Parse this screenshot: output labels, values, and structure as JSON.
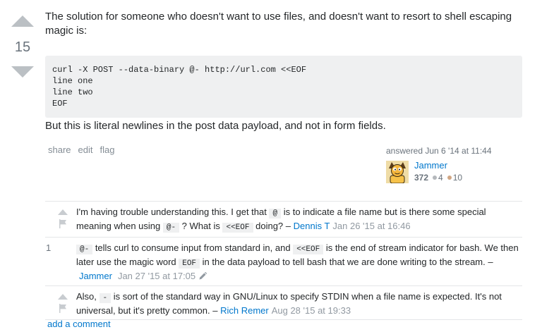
{
  "vote": {
    "count": "15"
  },
  "post": {
    "intro": "The solution for someone who doesn't want to use files, and doesn't want to resort to shell escaping magic is:",
    "code_lines": [
      "curl -X POST --data-binary @- http://url.com <<EOF",
      "line one",
      "line two",
      "EOF"
    ],
    "outro": "But this is literal newlines in the post data payload, and not in form fields."
  },
  "post_menu": {
    "share": "share",
    "edit": "edit",
    "flag": "flag"
  },
  "user_card": {
    "action_time": "answered Jun 6 '14 at 11:44",
    "name": "Jammer",
    "reputation": "372",
    "silver_badges": "4",
    "bronze_badges": "10"
  },
  "comments": [
    {
      "body": [
        {
          "text": "I'm having trouble understanding this. I get that "
        },
        {
          "code": "@"
        },
        {
          "text": " is to indicate a file name but is there some special meaning when using "
        },
        {
          "code": "@-"
        },
        {
          "text": " ? What is "
        },
        {
          "code": "<<EOF"
        },
        {
          "text": " doing? – "
        }
      ],
      "author": "Dennis T",
      "date": "Jan 26 '15 at 16:46"
    },
    {
      "score": "1",
      "body": [
        {
          "code": "@-"
        },
        {
          "text": " tells curl to consume input from standard in, and "
        },
        {
          "code": "<<EOF"
        },
        {
          "text": " is the end of stream indicator for bash. We then later use the magic word "
        },
        {
          "code": "EOF"
        },
        {
          "text": " in the data payload to tell bash that we are done writing to the stream. – "
        }
      ],
      "author": "Jammer",
      "date": "Jan 27 '15 at 17:05"
    },
    {
      "body": [
        {
          "text": "Also, "
        },
        {
          "code": "-"
        },
        {
          "text": " is sort of the standard way in GNU/Linux to specify STDIN when a file name is expected. It's not universal, but it's pretty common. – "
        }
      ],
      "author": "Rich Remer",
      "date": "Aug 28 '15 at 19:33"
    }
  ],
  "add_comment": "add a comment",
  "icons": {
    "upvote": "upvote-arrow-icon",
    "downvote": "downvote-arrow-icon",
    "comment_upvote": "comment-upvote-icon",
    "comment_flag": "flag-icon",
    "edited": "pencil-icon"
  },
  "colors": {
    "text": "#242729",
    "link": "#0077cc",
    "muted": "#6a737c",
    "menu": "#848d95",
    "date": "#9199a1",
    "code_bg": "#eff0f1",
    "vote_arrow": "#bbc0c4",
    "comment_icon": "#c8ccd0",
    "badge_silver": "#b4b8bc",
    "badge_bronze": "#d1a684",
    "divider": "#e4e6e8"
  }
}
